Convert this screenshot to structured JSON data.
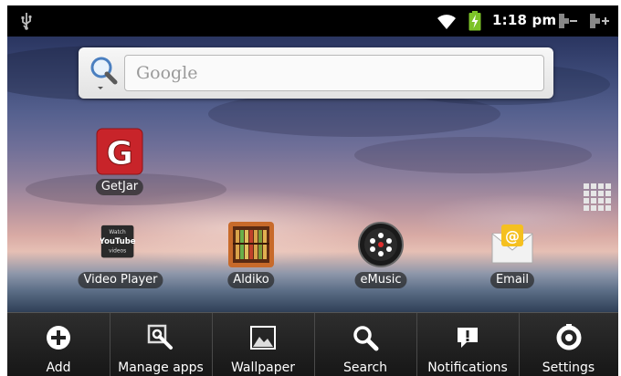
{
  "status_bar": {
    "time": "1:18 pm",
    "icons": [
      "usb-icon",
      "wifi-icon",
      "battery-charging-icon",
      "volume-down-icon",
      "volume-up-icon"
    ]
  },
  "search": {
    "placeholder": "Google",
    "icon": "search-icon"
  },
  "apps": [
    {
      "label": "GetJar",
      "icon": "getjar-icon"
    },
    {
      "label": "Video Player",
      "icon": "youtube-icon",
      "icon_text": [
        "Watch",
        "YouTube",
        "videos"
      ]
    },
    {
      "label": "Aldiko",
      "icon": "bookshelf-icon"
    },
    {
      "label": "eMusic",
      "icon": "emusic-icon"
    },
    {
      "label": "Email",
      "icon": "envelope-icon"
    }
  ],
  "app_drawer": {
    "icon": "app-grid-icon"
  },
  "menu": [
    {
      "label": "Add",
      "icon": "add-icon"
    },
    {
      "label": "Manage apps",
      "icon": "manage-apps-icon"
    },
    {
      "label": "Wallpaper",
      "icon": "wallpaper-icon"
    },
    {
      "label": "Search",
      "icon": "search-icon"
    },
    {
      "label": "Notifications",
      "icon": "notification-icon"
    },
    {
      "label": "Settings",
      "icon": "settings-icon"
    }
  ],
  "colors": {
    "status_bar_bg": "#000000",
    "menu_bg": "#1e1e1e",
    "getjar_red": "#c8242a",
    "battery_green": "#7cc228"
  }
}
